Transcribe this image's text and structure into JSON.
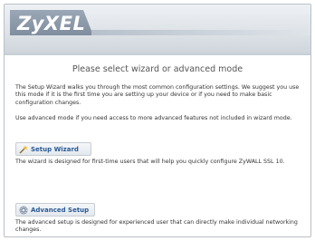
{
  "header": {
    "logo_text": "ZyXEL"
  },
  "main": {
    "title": "Please select wizard or advanced mode",
    "intro_text": "The Setup Wizard walks you through the most common configuration settings. We suggest you use this mode if it is the first time you are setting up your device or if you need to make basic configuration changes.",
    "advanced_intro_text": "Use advanced mode if you need access to more advanced features not included in wizard mode.",
    "wizard_button_label": "Setup Wizard",
    "wizard_description": "The wizard is designed for first-time users that will help you quickly configure ZyWALL SSL 10.",
    "advanced_button_label": "Advanced Setup",
    "advanced_description": "The advanced setup is designed for experienced user that can directly make individual networking changes."
  },
  "icons": {
    "wizard": "magic-wand-icon",
    "advanced": "gear-icon"
  }
}
